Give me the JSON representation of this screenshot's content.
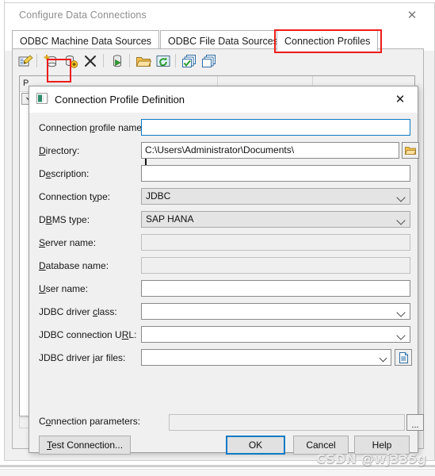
{
  "main_window": {
    "title": "Configure Data Connections",
    "close_label": "✕",
    "tabs": [
      {
        "label": "ODBC Machine Data Sources",
        "active": false
      },
      {
        "label": "ODBC File Data Sources",
        "active": false
      },
      {
        "label": "Connection Profiles",
        "active": true
      }
    ],
    "toolbar": [
      {
        "name": "edit-properties-icon",
        "title": "Edit"
      },
      {
        "name": "new-connection-profile-icon",
        "title": "New connection profile"
      },
      {
        "name": "add-data-source-icon",
        "title": "Add data source"
      },
      {
        "name": "delete-icon",
        "title": "Delete"
      },
      {
        "name": "connect-icon",
        "title": "Connect"
      },
      {
        "name": "open-folder-icon",
        "title": "Open"
      },
      {
        "name": "refresh-icon",
        "title": "Refresh"
      },
      {
        "name": "select-all-icon",
        "title": "Select all"
      },
      {
        "name": "copy-icon",
        "title": "Copy"
      }
    ],
    "list_columns": [
      "P",
      "",
      ""
    ],
    "highlight_color": "#ee1b1b"
  },
  "dialog": {
    "title": "Connection Profile Definition",
    "close_label": "✕",
    "fields": [
      {
        "label_pre": "Connection ",
        "label_key": "p",
        "label_post": "rofile name:",
        "value": "",
        "type": "text",
        "state": "focused",
        "name": "connection-profile-name"
      },
      {
        "label_pre": "",
        "label_key": "D",
        "label_post": "irectory:",
        "value": "C:\\Users\\Administrator\\Documents\\",
        "type": "text",
        "state": "normal",
        "name": "directory"
      },
      {
        "label_pre": "D",
        "label_key": "e",
        "label_post": "scription:",
        "value": "",
        "type": "text",
        "state": "normal",
        "name": "description"
      },
      {
        "label_pre": "Connection t",
        "label_key": "y",
        "label_post": "pe:",
        "value": "JDBC",
        "type": "combo",
        "state": "grey",
        "name": "connection-type"
      },
      {
        "label_pre": "D",
        "label_key": "B",
        "label_post": "MS type:",
        "value": "SAP HANA",
        "type": "combo",
        "state": "grey",
        "name": "dbms-type"
      },
      {
        "label_pre": "",
        "label_key": "S",
        "label_post": "erver name:",
        "value": "",
        "type": "text",
        "state": "disabled",
        "name": "server-name"
      },
      {
        "label_pre": "",
        "label_key": "D",
        "label_post": "atabase name:",
        "value": "",
        "type": "text",
        "state": "disabled",
        "name": "database-name"
      },
      {
        "label_pre": "",
        "label_key": "U",
        "label_post": "ser name:",
        "value": "",
        "type": "text",
        "state": "normal",
        "name": "user-name"
      },
      {
        "label_pre": "JDBC driver ",
        "label_key": "c",
        "label_post": "lass:",
        "value": "",
        "type": "combo",
        "state": "normal",
        "name": "jdbc-driver-class"
      },
      {
        "label_pre": "JDBC connection U",
        "label_key": "R",
        "label_post": "L:",
        "value": "",
        "type": "combo",
        "state": "normal",
        "name": "jdbc-connection-url"
      },
      {
        "label_pre": "JDBC driver ",
        "label_key": "j",
        "label_post": "ar files:",
        "value": "",
        "type": "combo-browse",
        "state": "normal",
        "name": "jdbc-driver-jar-files"
      }
    ],
    "connection_parameters": {
      "label_pre": "C",
      "label_key": "o",
      "label_post": "nnection parameters:",
      "value": "",
      "browse_label": "..."
    },
    "buttons": [
      {
        "label": "Test Connection...",
        "name": "test-connection-button",
        "default": false
      },
      {
        "label": "OK",
        "name": "ok-button",
        "default": true
      },
      {
        "label": "Cancel",
        "name": "cancel-button",
        "default": false
      },
      {
        "label": "Help",
        "name": "help-button",
        "default": false
      }
    ],
    "accent_color": "#0b7ac4"
  },
  "watermark": {
    "text": "CSDN @wj335g"
  }
}
